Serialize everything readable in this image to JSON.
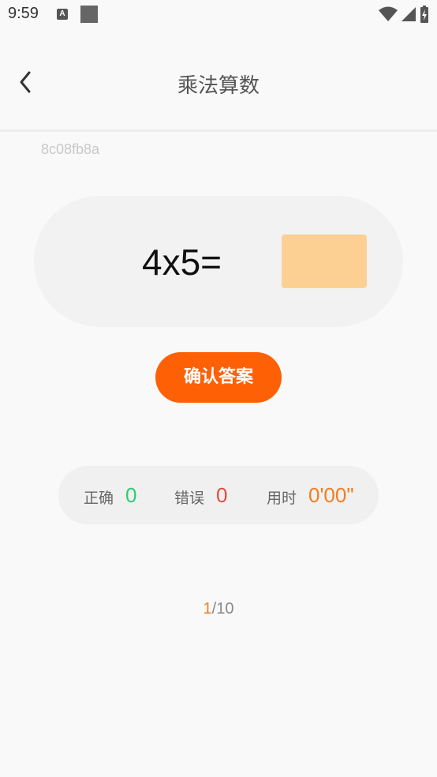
{
  "status_bar": {
    "time": "9:59",
    "notification_icon_letter": "A",
    "icons": [
      "a-notification-icon",
      "square-notification-icon",
      "wifi-icon",
      "signal-icon",
      "battery-charging-icon"
    ]
  },
  "header": {
    "title": "乘法算数",
    "back_icon": "chevron-left-icon"
  },
  "code": "8c08fb8a",
  "question": {
    "expression": "4x5=",
    "answer_value": ""
  },
  "confirm_button_label": "确认答案",
  "stats": {
    "correct_label": "正确",
    "correct_value": "0",
    "wrong_label": "错误",
    "wrong_value": "0",
    "time_label": "用时",
    "time_value": "0'00\""
  },
  "progress": {
    "current": "1",
    "separator": "/",
    "total": "10"
  },
  "colors": {
    "accent": "#fe6006",
    "answer_box": "#fcd093",
    "correct": "#2ecc71",
    "wrong": "#e74c3c",
    "time": "#f57c1f"
  }
}
